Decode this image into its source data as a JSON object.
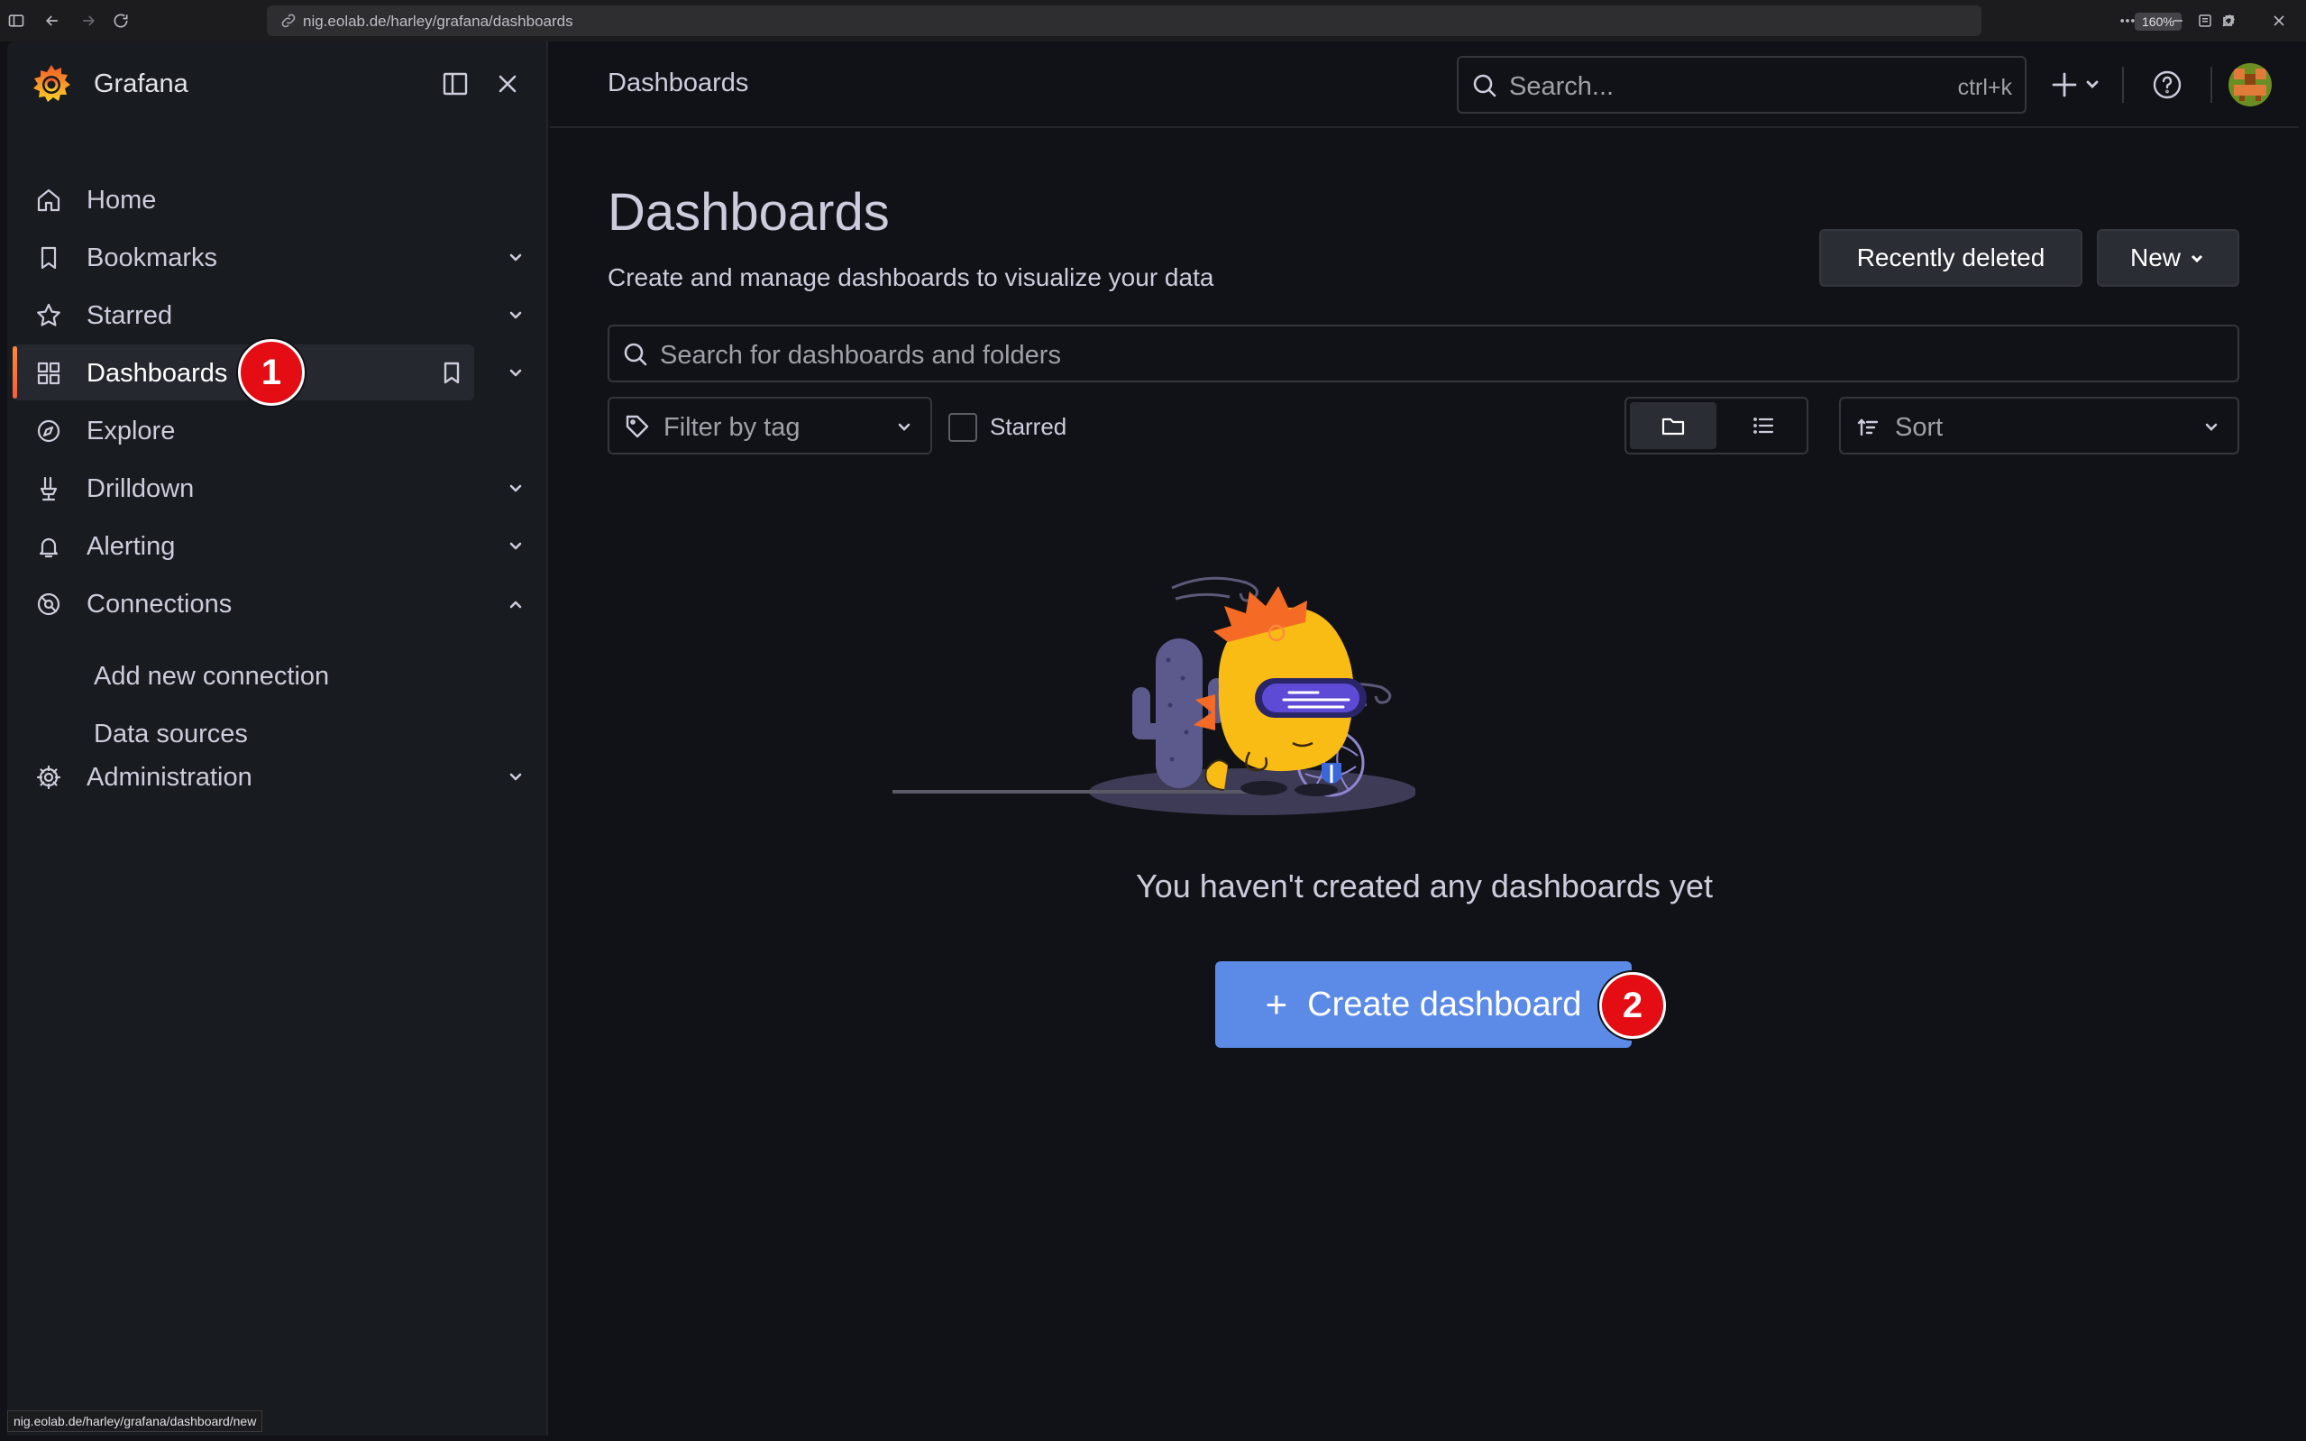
{
  "browser": {
    "url": "nig.eolab.de/harley/grafana/dashboards",
    "zoom": "160%",
    "status_url": "nig.eolab.de/harley/grafana/dashboard/new"
  },
  "sidebar": {
    "brand": "Grafana",
    "items": [
      {
        "label": "Home",
        "icon": "home-icon"
      },
      {
        "label": "Bookmarks",
        "icon": "bookmark-icon"
      },
      {
        "label": "Starred",
        "icon": "star-icon"
      },
      {
        "label": "Dashboards",
        "icon": "apps-icon",
        "active": true
      },
      {
        "label": "Explore",
        "icon": "compass-icon"
      },
      {
        "label": "Drilldown",
        "icon": "drilldown-icon"
      },
      {
        "label": "Alerting",
        "icon": "bell-icon"
      },
      {
        "label": "Connections",
        "icon": "connections-icon",
        "expanded": true
      },
      {
        "label": "Administration",
        "icon": "cog-icon"
      }
    ],
    "sub_items": [
      "Add new connection",
      "Data sources"
    ]
  },
  "topbar": {
    "breadcrumb": "Dashboards",
    "search_placeholder": "Search...",
    "search_shortcut": "ctrl+k"
  },
  "page": {
    "title": "Dashboards",
    "subtitle": "Create and manage dashboards to visualize your data",
    "recently_deleted": "Recently deleted",
    "new_button": "New",
    "search_placeholder": "Search for dashboards and folders",
    "tag_filter_placeholder": "Filter by tag",
    "starred_label": "Starred",
    "sort_label": "Sort",
    "empty_message": "You haven't created any dashboards yet",
    "create_button": "Create dashboard"
  },
  "annotations": {
    "badge1": "1",
    "badge2": "2"
  },
  "colors": {
    "accent": "#f55f3e",
    "primary_button": "#5b8be6",
    "badge": "#e40d14"
  }
}
